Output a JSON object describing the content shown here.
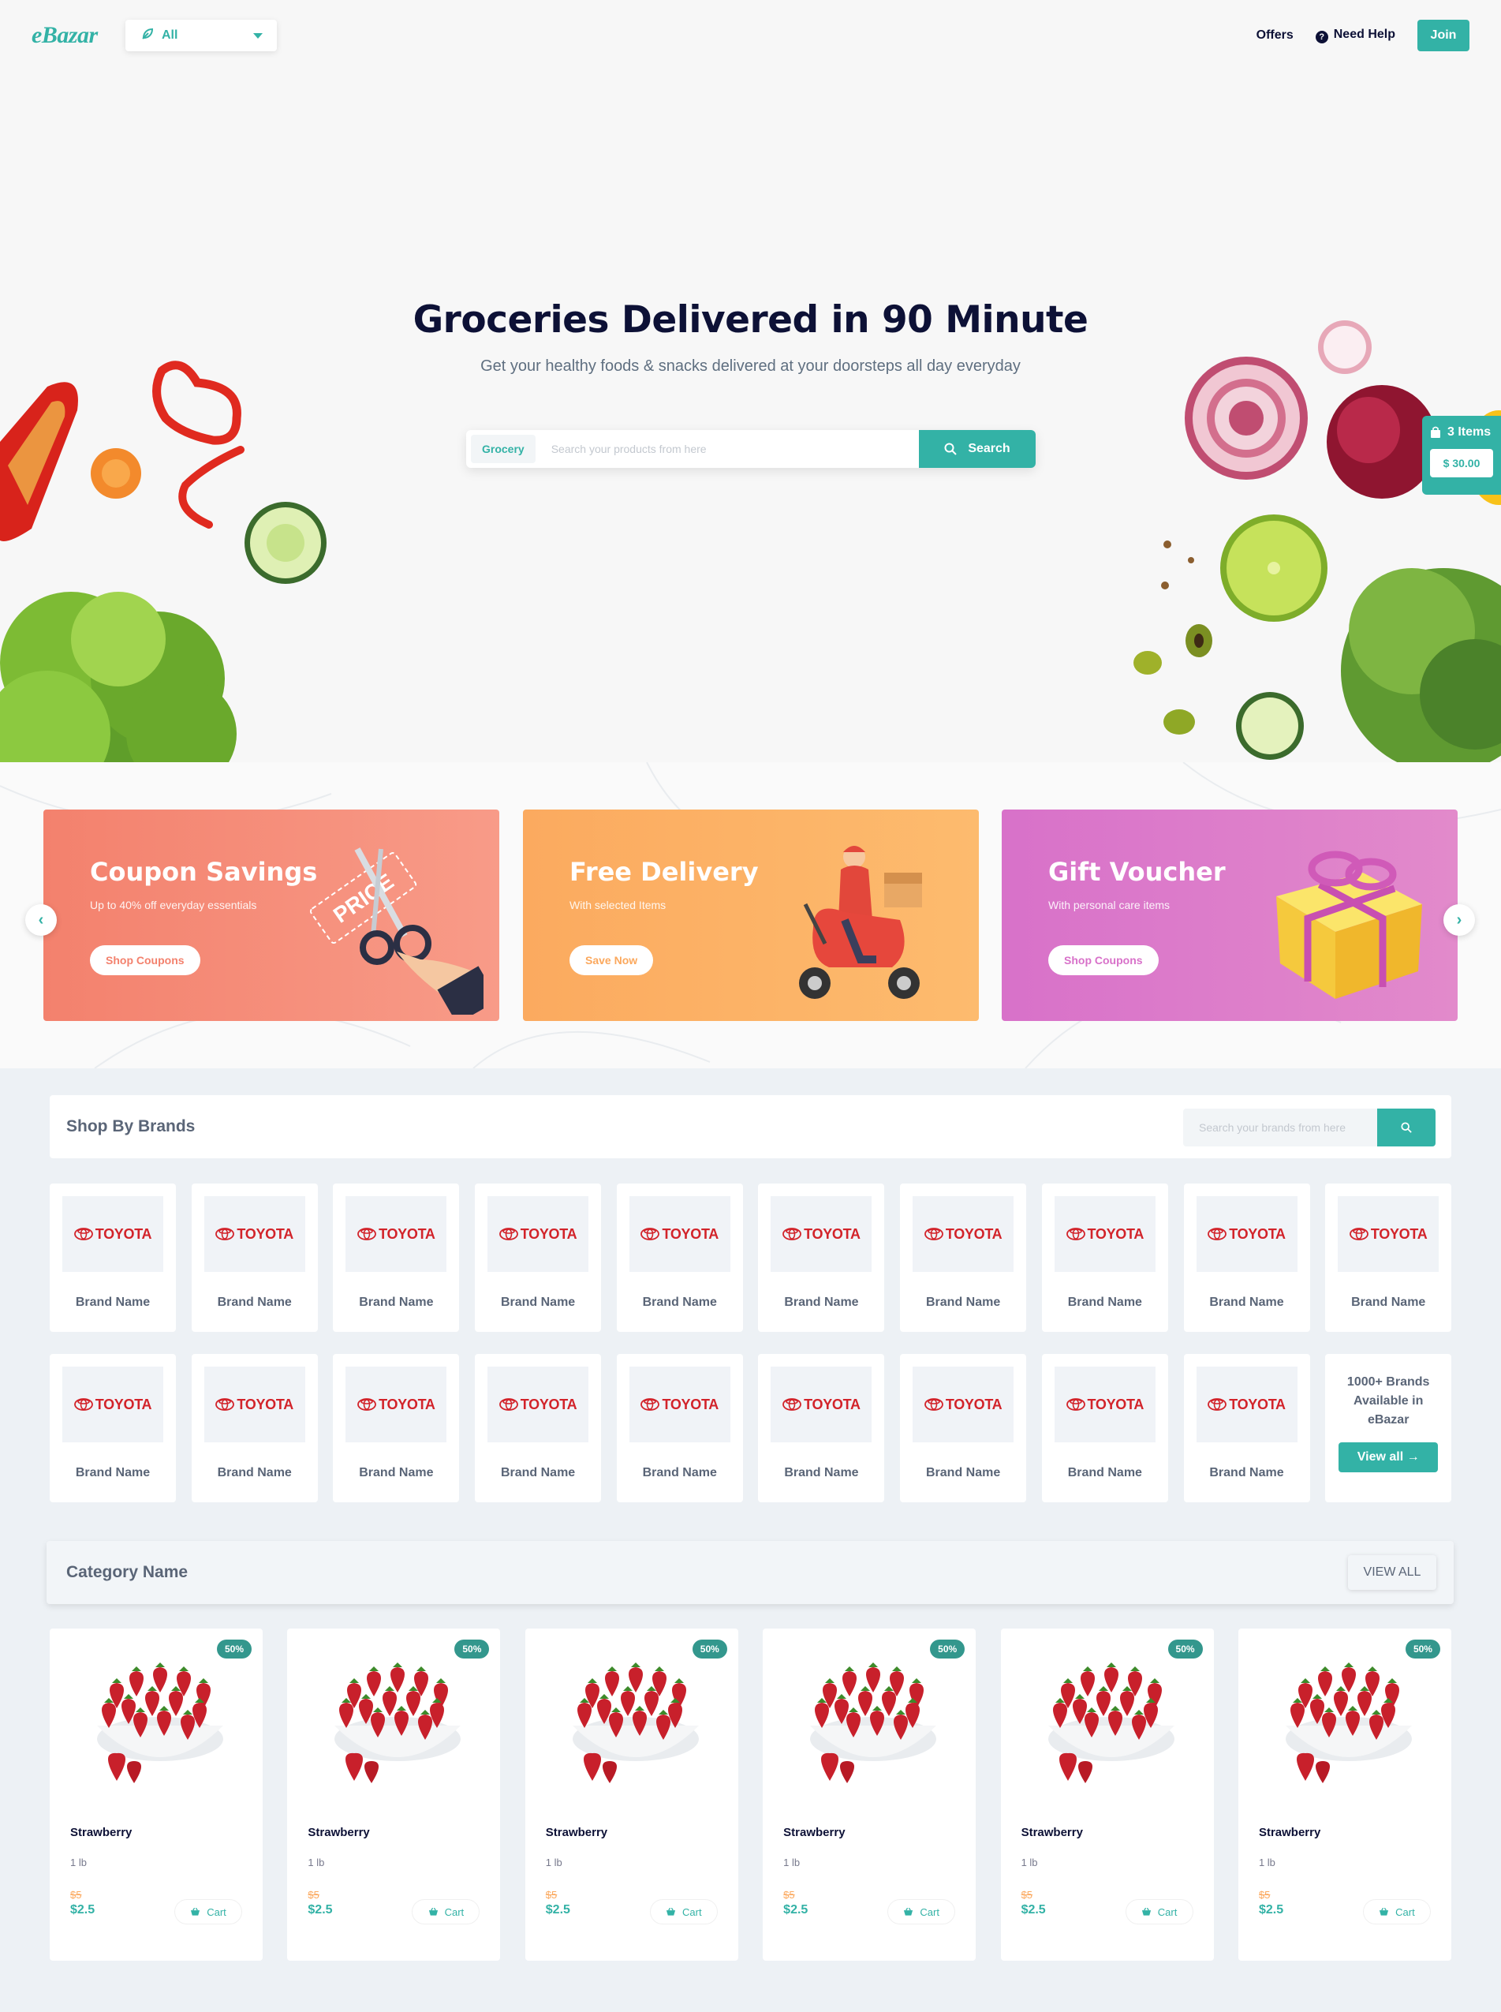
{
  "header": {
    "logo": "eBazar",
    "category_select": "All",
    "offers_link": "Offers",
    "help_link": "Need Help",
    "join_button": "Join"
  },
  "hero": {
    "title": "Groceries Delivered in 90 Minute",
    "subtitle": "Get your healthy foods & snacks delivered at your doorsteps all day everyday",
    "search_category": "Grocery",
    "search_placeholder": "Search your products from here",
    "search_button": "Search"
  },
  "cart": {
    "count": "3 Items",
    "total": "$ 30.00"
  },
  "offers": [
    {
      "title": "Coupon Savings",
      "desc": "Up to 40% off everyday essentials",
      "button": "Shop Coupons"
    },
    {
      "title": "Free Delivery",
      "desc": "With selected Items",
      "button": "Save Now"
    },
    {
      "title": "Gift Voucher",
      "desc": "With personal care items",
      "button": "Shop Coupons"
    }
  ],
  "offer_art": {
    "price_tag": "PRICE"
  },
  "brands": {
    "title": "Shop By Brands",
    "search_placeholder": "Search your brands from here",
    "logo_text": "TOYOTA",
    "items": [
      {
        "name": "Brand Name"
      },
      {
        "name": "Brand Name"
      },
      {
        "name": "Brand Name"
      },
      {
        "name": "Brand Name"
      },
      {
        "name": "Brand Name"
      },
      {
        "name": "Brand Name"
      },
      {
        "name": "Brand Name"
      },
      {
        "name": "Brand Name"
      },
      {
        "name": "Brand Name"
      },
      {
        "name": "Brand Name"
      },
      {
        "name": "Brand Name"
      },
      {
        "name": "Brand Name"
      },
      {
        "name": "Brand Name"
      },
      {
        "name": "Brand Name"
      },
      {
        "name": "Brand Name"
      },
      {
        "name": "Brand Name"
      },
      {
        "name": "Brand Name"
      },
      {
        "name": "Brand Name"
      },
      {
        "name": "Brand Name"
      }
    ],
    "more_text": "1000+ Brands Available in eBazar",
    "view_all": "View all"
  },
  "category": {
    "title": "Category Name",
    "view_all": "VIEW ALL",
    "products": [
      {
        "name": "Strawberry",
        "unit": "1 lb",
        "old_price": "$5",
        "price": "$2.5",
        "discount": "50%",
        "cart": "Cart"
      },
      {
        "name": "Strawberry",
        "unit": "1 lb",
        "old_price": "$5",
        "price": "$2.5",
        "discount": "50%",
        "cart": "Cart"
      },
      {
        "name": "Strawberry",
        "unit": "1 lb",
        "old_price": "$5",
        "price": "$2.5",
        "discount": "50%",
        "cart": "Cart"
      },
      {
        "name": "Strawberry",
        "unit": "1 lb",
        "old_price": "$5",
        "price": "$2.5",
        "discount": "50%",
        "cart": "Cart"
      },
      {
        "name": "Strawberry",
        "unit": "1 lb",
        "old_price": "$5",
        "price": "$2.5",
        "discount": "50%",
        "cart": "Cart"
      },
      {
        "name": "Strawberry",
        "unit": "1 lb",
        "old_price": "$5",
        "price": "$2.5",
        "discount": "50%",
        "cart": "Cart"
      }
    ]
  },
  "colors": {
    "primary": "#33b2a6",
    "coupon": "#f3816d",
    "delivery": "#fba85d",
    "gift": "#d871c9",
    "text_dark": "#0d1136"
  }
}
